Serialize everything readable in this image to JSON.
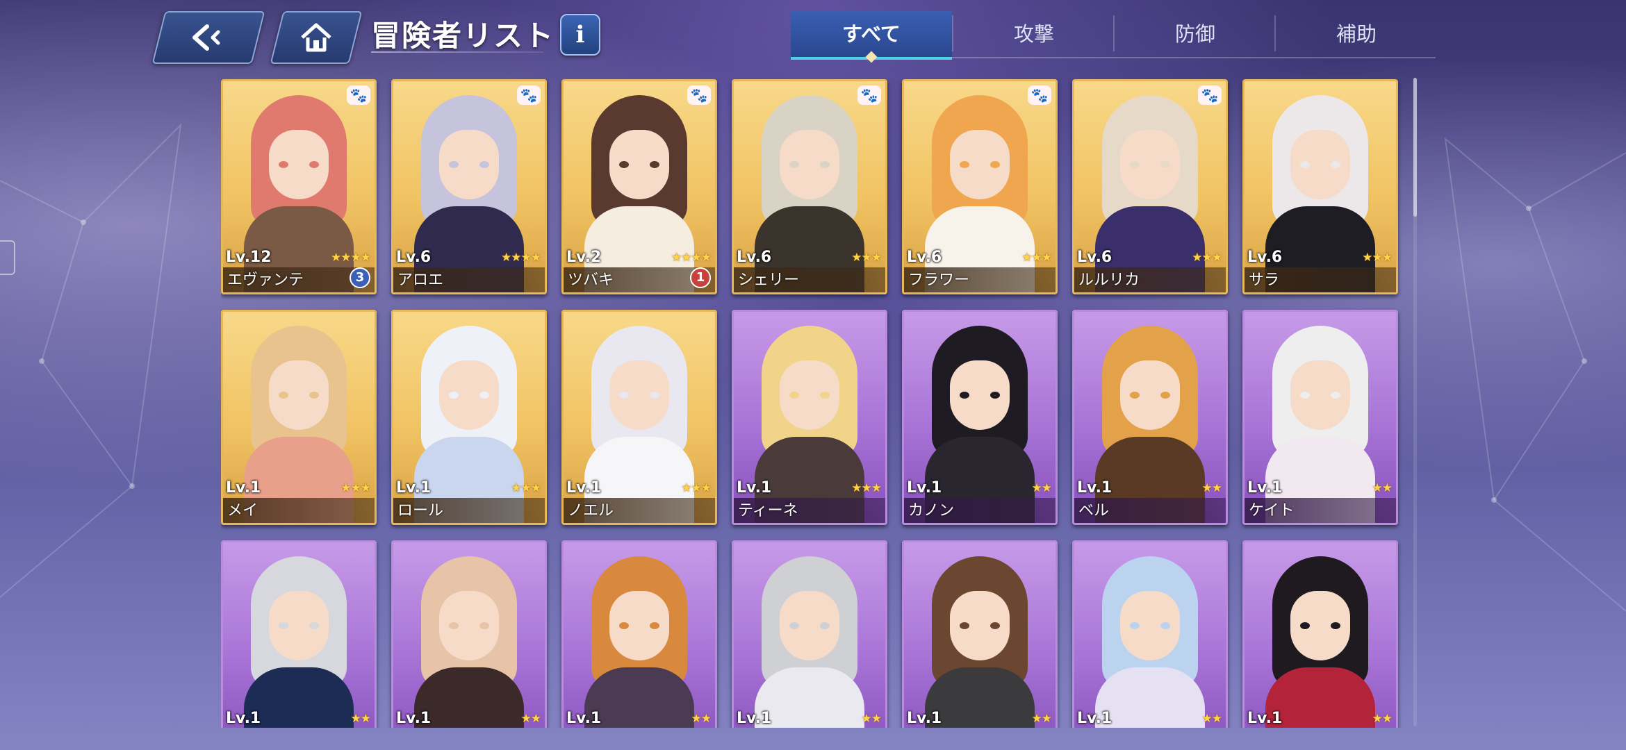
{
  "header": {
    "title": "冒険者リスト",
    "info_label": "i",
    "back_icon": "back-arrow-icon",
    "home_icon": "home-icon"
  },
  "tabs": [
    {
      "label": "すべて",
      "active": true
    },
    {
      "label": "攻撃",
      "active": false
    },
    {
      "label": "防御",
      "active": false
    },
    {
      "label": "補助",
      "active": false
    }
  ],
  "colors": {
    "accent": "#4fd2e3",
    "gold_card": "#f1c363",
    "purple_card": "#a773d6"
  },
  "adventurers": [
    {
      "name": "エヴァンテ",
      "level": "Lv.12",
      "stars": "★★★★",
      "rarity": "gold",
      "paw": true,
      "badge": "3",
      "badge_color": "blue",
      "hair": "#e07a6e",
      "outfit": "#7a5a44"
    },
    {
      "name": "アロエ",
      "level": "Lv.6",
      "stars": "★★★★",
      "rarity": "gold",
      "paw": true,
      "badge": "",
      "hair": "#c6c3dc",
      "outfit": "#2f2a4e"
    },
    {
      "name": "ツバキ",
      "level": "Lv.2",
      "stars": "★★★★",
      "rarity": "gold",
      "paw": true,
      "badge": "1",
      "badge_color": "red",
      "hair": "#5a3a2e",
      "outfit": "#f4ede0"
    },
    {
      "name": "シェリー",
      "level": "Lv.6",
      "stars": "★★★",
      "rarity": "gold",
      "paw": true,
      "badge": "",
      "hair": "#d9d3c6",
      "outfit": "#3b342c"
    },
    {
      "name": "フラワー",
      "level": "Lv.6",
      "stars": "★★★",
      "rarity": "gold",
      "paw": true,
      "badge": "",
      "hair": "#f0a64e",
      "outfit": "#f7f2ea"
    },
    {
      "name": "ルルリカ",
      "level": "Lv.6",
      "stars": "★★★",
      "rarity": "gold",
      "paw": true,
      "badge": "",
      "hair": "#e6d9c8",
      "outfit": "#3a2f6a"
    },
    {
      "name": "サラ",
      "level": "Lv.6",
      "stars": "★★★",
      "rarity": "gold",
      "paw": false,
      "badge": "",
      "hair": "#ece8ea",
      "outfit": "#1f1d24"
    },
    {
      "name": "メイ",
      "level": "Lv.1",
      "stars": "★★★",
      "rarity": "gold",
      "paw": false,
      "badge": "",
      "hair": "#e8c38e",
      "outfit": "#e8a08a"
    },
    {
      "name": "ロール",
      "level": "Lv.1",
      "stars": "★★★",
      "rarity": "gold",
      "paw": false,
      "badge": "",
      "hair": "#eef1f8",
      "outfit": "#c9d6ee"
    },
    {
      "name": "ノエル",
      "level": "Lv.1",
      "stars": "★★★",
      "rarity": "gold",
      "paw": false,
      "badge": "",
      "hair": "#e9e7ef",
      "outfit": "#f6f5f8"
    },
    {
      "name": "ティーネ",
      "level": "Lv.1",
      "stars": "★★★",
      "rarity": "purple",
      "paw": false,
      "badge": "",
      "hair": "#f1d48a",
      "outfit": "#4a3b3a"
    },
    {
      "name": "カノン",
      "level": "Lv.1",
      "stars": "★★",
      "rarity": "purple",
      "paw": false,
      "badge": "",
      "hair": "#1f1b22",
      "outfit": "#2a2630"
    },
    {
      "name": "ベル",
      "level": "Lv.1",
      "stars": "★★",
      "rarity": "purple",
      "paw": false,
      "badge": "",
      "hair": "#e3a24a",
      "outfit": "#5a3a24"
    },
    {
      "name": "ケイト",
      "level": "Lv.1",
      "stars": "★★",
      "rarity": "purple",
      "paw": false,
      "badge": "",
      "hair": "#eeeeee",
      "outfit": "#f2e8f0"
    },
    {
      "name": "",
      "level": "Lv.1",
      "stars": "★★",
      "rarity": "purple",
      "paw": false,
      "badge": "",
      "hair": "#d6d8de",
      "outfit": "#1d2c55"
    },
    {
      "name": "",
      "level": "Lv.1",
      "stars": "★★",
      "rarity": "purple",
      "paw": false,
      "badge": "",
      "hair": "#e7c3a8",
      "outfit": "#3c2a2a"
    },
    {
      "name": "",
      "level": "Lv.1",
      "stars": "★★",
      "rarity": "purple",
      "paw": false,
      "badge": "",
      "hair": "#d9893e",
      "outfit": "#4a3a52"
    },
    {
      "name": "",
      "level": "Lv.1",
      "stars": "★★",
      "rarity": "purple",
      "paw": false,
      "badge": "",
      "hair": "#cfd0d4",
      "outfit": "#e9e9ef"
    },
    {
      "name": "",
      "level": "Lv.1",
      "stars": "★★",
      "rarity": "purple",
      "paw": false,
      "badge": "",
      "hair": "#6b4630",
      "outfit": "#3b3a3c"
    },
    {
      "name": "",
      "level": "Lv.1",
      "stars": "★★",
      "rarity": "purple",
      "paw": false,
      "badge": "",
      "hair": "#bcd3f0",
      "outfit": "#e6e1f2"
    },
    {
      "name": "",
      "level": "Lv.1",
      "stars": "★★",
      "rarity": "purple",
      "paw": false,
      "badge": "",
      "hair": "#1e1a20",
      "outfit": "#b3243a"
    }
  ]
}
